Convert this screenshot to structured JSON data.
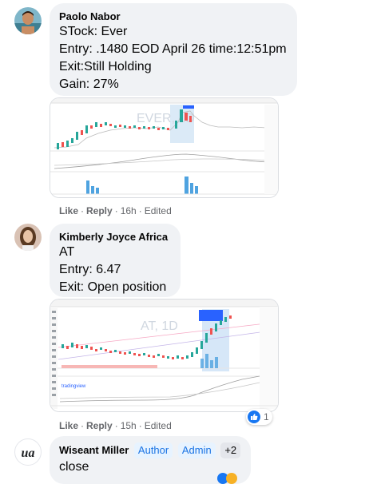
{
  "comments": [
    {
      "author": "Paolo Nabor",
      "lines": [
        "STock: Ever",
        "Entry: .1480 EOD April 26 time:12:51pm",
        "Exit:Still Holding",
        "Gain: 27%"
      ],
      "chart_caption": "EVER, 1D",
      "actions": {
        "like": "Like",
        "reply": "Reply",
        "time": "16h",
        "edited": "Edited"
      }
    },
    {
      "author": "Kimberly Joyce Africa",
      "lines": [
        "AT",
        "Entry: 6.47",
        "Exit: Open position"
      ],
      "chart_caption": "AT, 1D",
      "actions": {
        "like": "Like",
        "reply": "Reply",
        "time": "15h",
        "edited": "Edited"
      },
      "reaction_count": "1"
    },
    {
      "author": "Wiseant Miller",
      "badges": [
        "Author",
        "Admin",
        "+2"
      ],
      "lines": [
        "close"
      ],
      "avatar_text": "ua"
    }
  ],
  "colors": {
    "facebook_blue": "#1877f2",
    "bubble_bg": "#f0f2f5",
    "meta_grey": "#65676b",
    "chart_up": "#26a69a",
    "chart_down": "#ef5350",
    "volume_blue": "#4fa3e0"
  }
}
